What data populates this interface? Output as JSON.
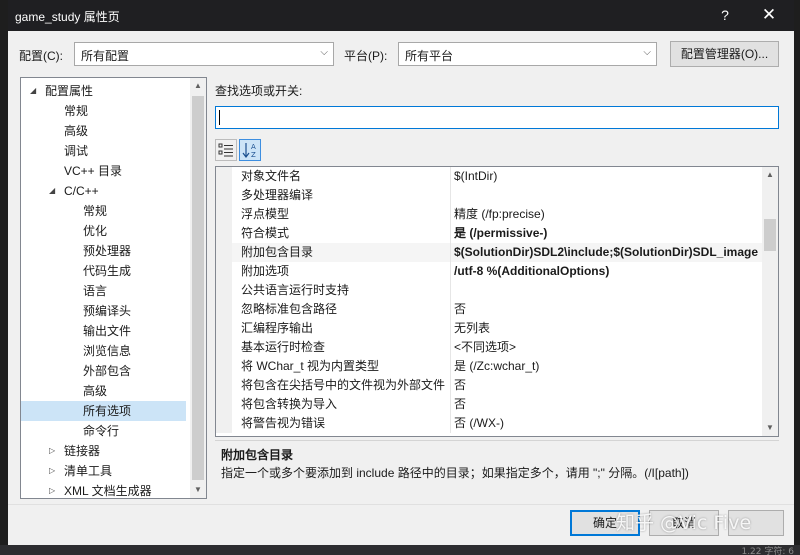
{
  "window": {
    "title": "game_study 属性页",
    "help_glyph": "?",
    "close_glyph": "✕"
  },
  "toolbar": {
    "config_label": "配置(C):",
    "config_value": "所有配置",
    "platform_label": "平台(P):",
    "platform_value": "所有平台",
    "manager_button": "配置管理器(O)..."
  },
  "tree": {
    "items": [
      {
        "label": "配置属性",
        "indent": 0,
        "expanded": true
      },
      {
        "label": "常规",
        "indent": 1
      },
      {
        "label": "高级",
        "indent": 1
      },
      {
        "label": "调试",
        "indent": 1
      },
      {
        "label": "VC++ 目录",
        "indent": 1
      },
      {
        "label": "C/C++",
        "indent": 1,
        "expanded": true
      },
      {
        "label": "常规",
        "indent": 2
      },
      {
        "label": "优化",
        "indent": 2
      },
      {
        "label": "预处理器",
        "indent": 2
      },
      {
        "label": "代码生成",
        "indent": 2
      },
      {
        "label": "语言",
        "indent": 2
      },
      {
        "label": "预编译头",
        "indent": 2
      },
      {
        "label": "输出文件",
        "indent": 2
      },
      {
        "label": "浏览信息",
        "indent": 2
      },
      {
        "label": "外部包含",
        "indent": 2
      },
      {
        "label": "高级",
        "indent": 2
      },
      {
        "label": "所有选项",
        "indent": 2,
        "selected": true
      },
      {
        "label": "命令行",
        "indent": 2
      },
      {
        "label": "链接器",
        "indent": 1,
        "collapsed": true
      },
      {
        "label": "清单工具",
        "indent": 1,
        "collapsed": true
      },
      {
        "label": "XML 文档生成器",
        "indent": 1,
        "collapsed": true
      }
    ]
  },
  "search": {
    "label": "查找选项或开关:",
    "value": ""
  },
  "grid": {
    "rows": [
      {
        "name": "对象文件名",
        "value": "$(IntDir)"
      },
      {
        "name": "多处理器编译",
        "value": ""
      },
      {
        "name": "浮点模型",
        "value": "精度 (/fp:precise)"
      },
      {
        "name": "符合模式",
        "value": "是 (/permissive-)",
        "bold": true
      },
      {
        "name": "附加包含目录",
        "value": "$(SolutionDir)SDL2\\include;$(SolutionDir)SDL_image",
        "bold": true,
        "highlight": true
      },
      {
        "name": "附加选项",
        "value": "/utf-8 %(AdditionalOptions)",
        "bold": true
      },
      {
        "name": "公共语言运行时支持",
        "value": ""
      },
      {
        "name": "忽略标准包含路径",
        "value": "否"
      },
      {
        "name": "汇编程序输出",
        "value": "无列表"
      },
      {
        "name": "基本运行时检查",
        "value": "<不同选项>"
      },
      {
        "name": "将 WChar_t 视为内置类型",
        "value": "是 (/Zc:wchar_t)"
      },
      {
        "name": "将包含在尖括号中的文件视为外部文件",
        "value": "否"
      },
      {
        "name": "将包含转换为导入",
        "value": "否"
      },
      {
        "name": "将警告视为错误",
        "value": "否 (/WX-)"
      }
    ]
  },
  "description": {
    "title": "附加包含目录",
    "text": "指定一个或多个要添加到 include 路径中的目录；如果指定多个，请用 \";\" 分隔。(/I[path])"
  },
  "footer": {
    "ok_button": "确定",
    "cancel_button": "取消",
    "watermark": "知乎 @Vic Five"
  },
  "background": {
    "status_text": "1.22   字符: 6"
  }
}
